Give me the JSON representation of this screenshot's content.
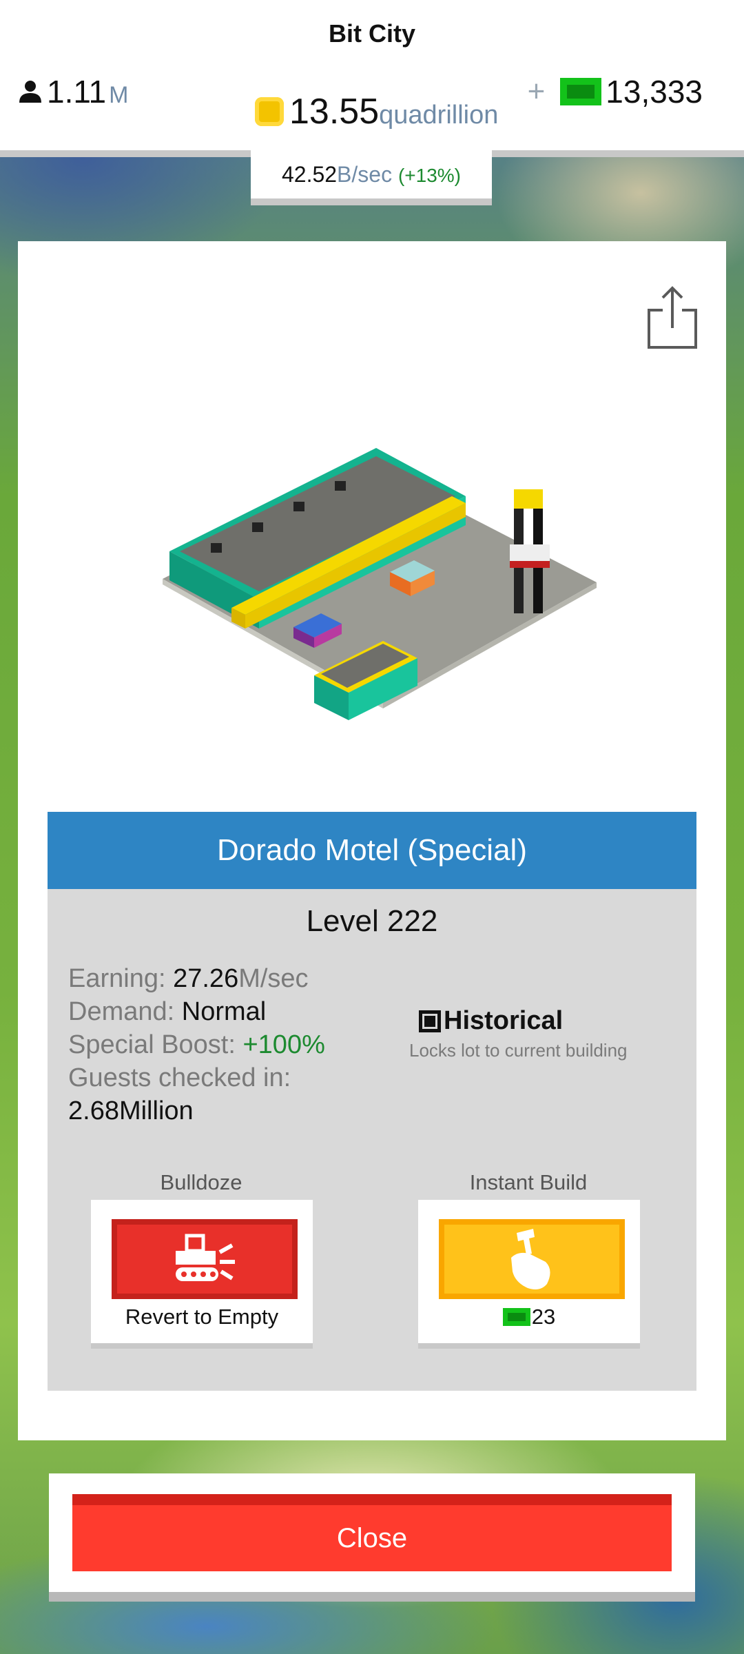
{
  "header": {
    "city_name": "Bit City",
    "population": "1.11",
    "population_unit": "M",
    "coins": "13.55",
    "coins_unit": "quadrillion",
    "cash_plus": "+",
    "cash": "13,333",
    "rate": "42.52",
    "rate_unit": "B/sec",
    "rate_boost": "(+13%)"
  },
  "building": {
    "name": "Dorado Motel (Special)",
    "level": "Level 222",
    "earning_label": "Earning:",
    "earning_value": "27.26",
    "earning_unit": "M/sec",
    "demand_label": "Demand:",
    "demand_value": "Normal",
    "boost_label": "Special Boost:",
    "boost_value": "+100%",
    "guests_label": "Guests checked in:",
    "guests_value": "2.68Million",
    "historical_title": "Historical",
    "historical_subtitle": "Locks lot to current building",
    "historical_checked": true
  },
  "actions": {
    "bulldoze_label": "Bulldoze",
    "bulldoze_caption": "Revert to Empty",
    "instant_label": "Instant Build",
    "instant_cost": "23"
  },
  "close_label": "Close",
  "icons": {
    "population": "person-icon",
    "coins": "coin-icon",
    "cash": "cash-icon",
    "share": "share-icon",
    "bulldoze": "bulldozer-icon",
    "instant": "hammer-hand-icon"
  },
  "colors": {
    "header_blue": "#2e85c4",
    "close_red": "#ff3b2e",
    "bulldoze_red": "#e8302a",
    "build_yellow": "#ffc21a",
    "boost_green": "#1d8a30"
  }
}
